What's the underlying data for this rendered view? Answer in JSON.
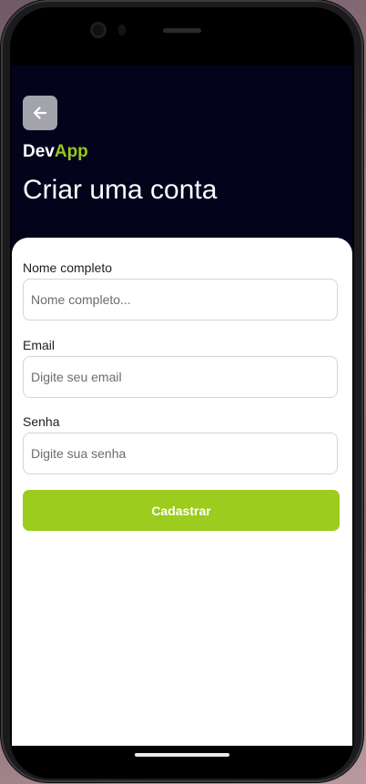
{
  "header": {
    "brand_dev": "Dev",
    "brand_app": "App",
    "title": "Criar uma conta"
  },
  "form": {
    "name_label": "Nome completo",
    "name_placeholder": "Nome completo...",
    "email_label": "Email",
    "email_placeholder": "Digite seu email",
    "password_label": "Senha",
    "password_placeholder": "Digite sua senha",
    "submit_label": "Cadastrar"
  },
  "colors": {
    "header_bg": "#04031c",
    "accent": "#9ccc1e",
    "card_bg": "#ffffff"
  },
  "icons": {
    "back": "arrow-left-icon"
  }
}
